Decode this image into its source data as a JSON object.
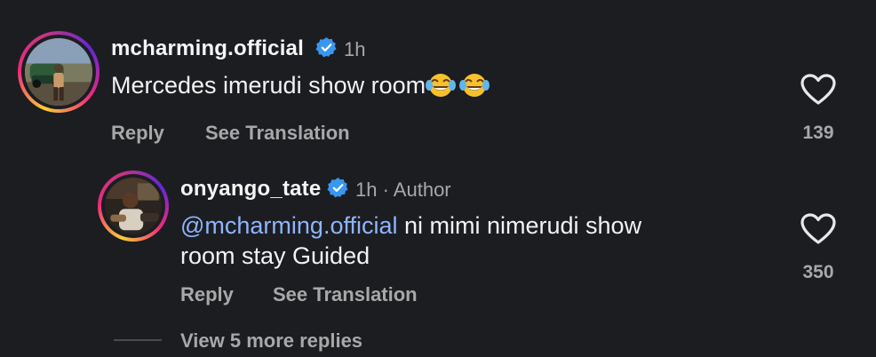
{
  "comment": {
    "username": "mcharming.official",
    "time": "1h",
    "text": "Mercedes imerudi show room",
    "reply_label": "Reply",
    "translate_label": "See Translation",
    "like_count": "139",
    "emoji_icons": [
      "joy-emoji",
      "joy-emoji"
    ]
  },
  "reply": {
    "username": "onyango_tate",
    "meta": "1h · Author",
    "mention": "@mcharming.official",
    "text_line1": " ni mimi nimerudi show",
    "text_line2": "room stay Guided",
    "reply_label": "Reply",
    "translate_label": "See Translation",
    "like_count": "350"
  },
  "thread": {
    "view_more_label": "View 5 more replies"
  },
  "colors": {
    "background": "#1c1d21",
    "verified": "#3897f0",
    "mention": "#8fb4ff",
    "muted": "#a8a8a8"
  }
}
